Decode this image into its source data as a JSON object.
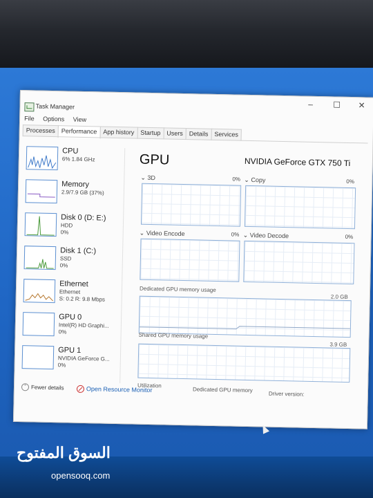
{
  "window": {
    "title": "Task Manager",
    "minimize": "–",
    "maximize": "☐",
    "close": "✕"
  },
  "menu": [
    "File",
    "Options",
    "View"
  ],
  "tabs": [
    "Processes",
    "Performance",
    "App history",
    "Startup",
    "Users",
    "Details",
    "Services"
  ],
  "active_tab": "Performance",
  "sidebar": [
    {
      "name": "CPU",
      "line1": "6% 1.84 GHz",
      "line2": ""
    },
    {
      "name": "Memory",
      "line1": "2.9/7.9 GB (37%)",
      "line2": ""
    },
    {
      "name": "Disk 0 (D: E:)",
      "line1": "HDD",
      "line2": "0%"
    },
    {
      "name": "Disk 1 (C:)",
      "line1": "SSD",
      "line2": "0%"
    },
    {
      "name": "Ethernet",
      "line1": "Ethernet",
      "line2": "S: 0.2 R: 9.8 Mbps"
    },
    {
      "name": "GPU 0",
      "line1": "Intel(R) HD Graphi...",
      "line2": "0%"
    },
    {
      "name": "GPU 1",
      "line1": "NVIDIA GeForce G...",
      "line2": "0%"
    }
  ],
  "main": {
    "title": "GPU",
    "model": "NVIDIA GeForce GTX 750 Ti",
    "engines": [
      {
        "label": "3D",
        "percent": "0%"
      },
      {
        "label": "Copy",
        "percent": "0%"
      },
      {
        "label": "Video Encode",
        "percent": "0%"
      },
      {
        "label": "Video Decode",
        "percent": "0%"
      }
    ],
    "dedicated_label": "Dedicated GPU memory usage",
    "dedicated_max": "2.0 GB",
    "shared_label": "Shared GPU memory usage",
    "shared_max": "3.9 GB",
    "stats_labels": [
      "Utilization",
      "Dedicated GPU memory",
      "Driver version:"
    ]
  },
  "footer": {
    "fewer_details": "Fewer details",
    "open_resource_monitor": "Open Resource Monitor"
  },
  "watermark": {
    "arabic": "السوق المفتوح",
    "latin": "opensooq.com"
  }
}
